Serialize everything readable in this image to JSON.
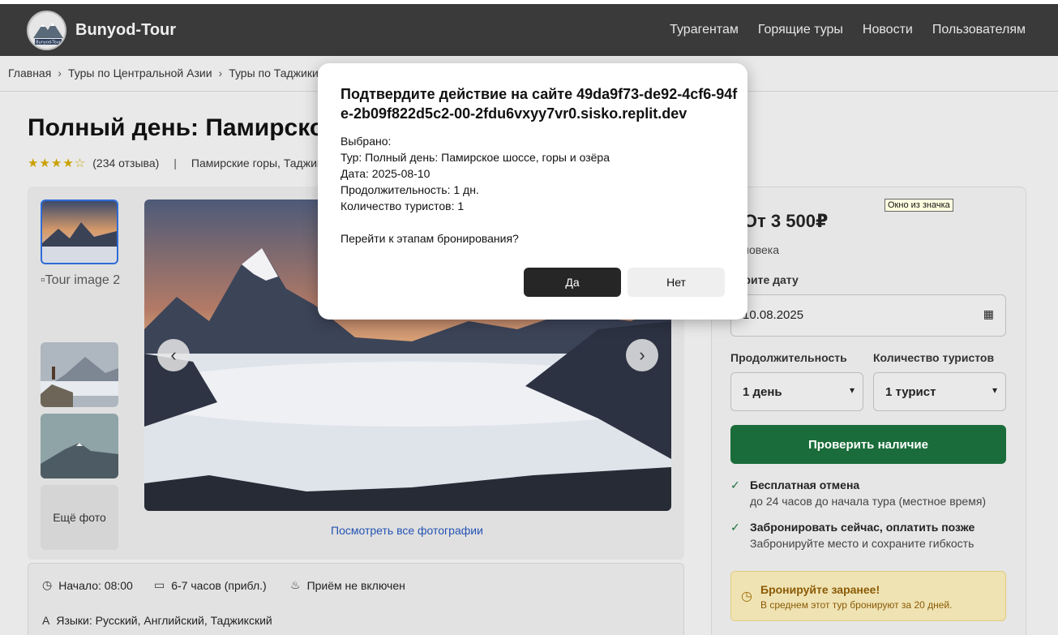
{
  "header": {
    "brand": "Bunyod-Tour",
    "logo_text": "Bunyod-Tour",
    "nav": [
      "Турагентам",
      "Горящие туры",
      "Новости",
      "Пользователям"
    ]
  },
  "breadcrumbs": [
    "Главная",
    "Туры по Центральной Азии",
    "Туры по Таджики"
  ],
  "tour": {
    "title": "Полный день: Памирско",
    "stars": "★★★★☆",
    "reviews": "(234 отзыва)",
    "location": "Памирские горы, Таджик"
  },
  "gallery": {
    "broken_alt": "Tour image 2",
    "more_label": "Ещё фото",
    "view_all": "Посмотреть все фотографии",
    "prev_icon": "‹",
    "next_icon": "›"
  },
  "info": {
    "start": "Начало: 08:00",
    "duration": "6-7 часов (прибл.)",
    "meal": "Приём не включен",
    "languages": "Языки: Русский, Английский, Таджикский"
  },
  "booking": {
    "price": "т От 3 500₽",
    "per_person": "человека",
    "date_label": "берите дату",
    "date_value": "10.08.2025",
    "duration_label": "Продолжительность",
    "tourists_label": "Количество туристов",
    "duration_value": "1 день",
    "tourists_value": "1 турист",
    "check_button": "Проверить наличие",
    "features": [
      {
        "title": "Бесплатная отмена",
        "sub": "до 24 часов до начала тура (местное время)"
      },
      {
        "title": "Забронировать сейчас, оплатить позже",
        "sub": "Забронируйте место и сохраните гибкость"
      }
    ],
    "notice_title": "Бронируйте заранее!",
    "notice_sub": "В среднем этот тур бронируют за 20 дней."
  },
  "tooltip": "Окно из значка",
  "dialog": {
    "title": "Подтвердите действие на сайте 49da9f73-de92-4cf6-94fe-2b09f822d5c2-00-2fdu6vxyy7vr0.sisko.replit.dev",
    "lines": [
      "Выбрано:",
      "Тур: Полный день: Памирское шоссе, горы и озёра",
      "Дата: 2025-08-10",
      "Продолжительность: 1 дн.",
      "Количество туристов: 1",
      "",
      "Перейти к этапам бронирования?"
    ],
    "yes": "Да",
    "no": "Нет"
  },
  "colors": {
    "header_bg": "#3a3a3a",
    "accent_green": "#1a6d3a",
    "link_blue": "#2453b3",
    "dialog_yes_bg": "#262626"
  }
}
